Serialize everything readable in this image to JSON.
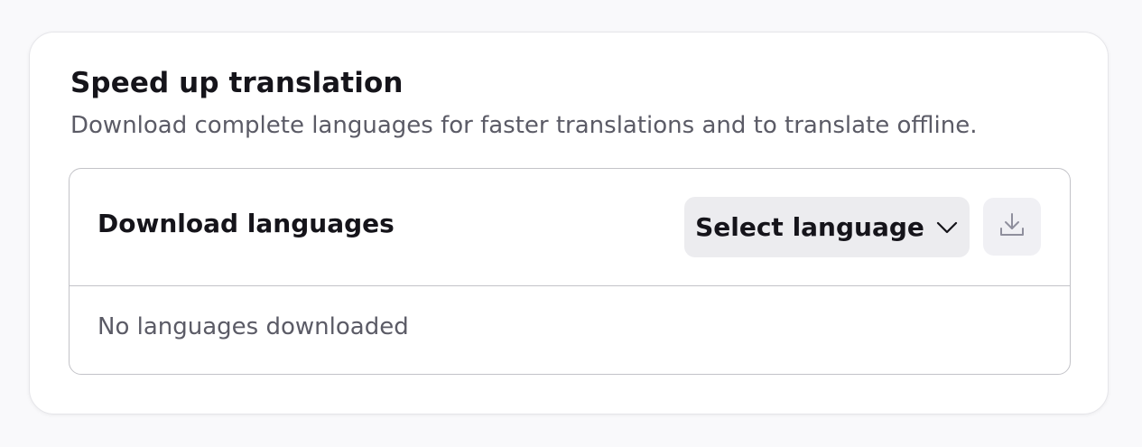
{
  "section": {
    "title": "Speed up translation",
    "description": "Download complete languages for faster translations and to translate offline."
  },
  "download_box": {
    "title": "Download languages",
    "select_label": "Select language",
    "select_icon": "chevron-down-icon",
    "download_icon": "download-icon",
    "empty_message": "No languages downloaded"
  },
  "colors": {
    "background": "#f9f9fb",
    "card": "#ffffff",
    "button_bg": "#ececef",
    "disabled_icon": "#8f8f9d",
    "text_primary": "#15141a",
    "text_secondary": "#5b5b66"
  }
}
